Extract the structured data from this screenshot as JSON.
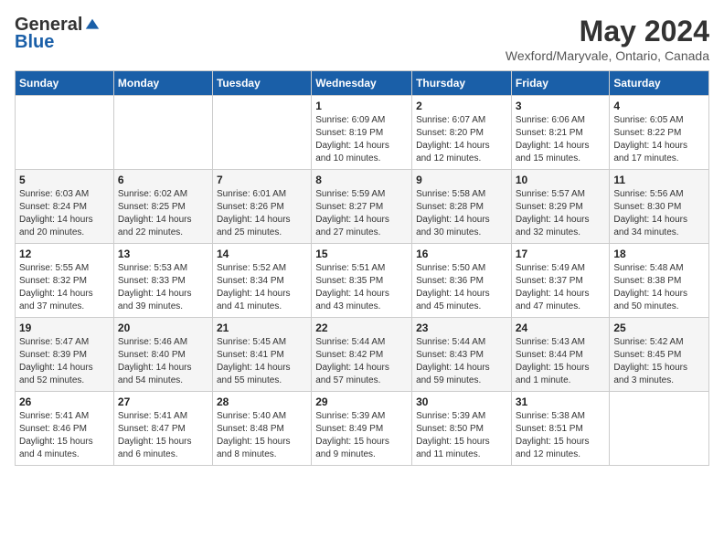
{
  "logo": {
    "general": "General",
    "blue": "Blue"
  },
  "header": {
    "month": "May 2024",
    "location": "Wexford/Maryvale, Ontario, Canada"
  },
  "weekdays": [
    "Sunday",
    "Monday",
    "Tuesday",
    "Wednesday",
    "Thursday",
    "Friday",
    "Saturday"
  ],
  "weeks": [
    [
      {
        "day": "",
        "info": ""
      },
      {
        "day": "",
        "info": ""
      },
      {
        "day": "",
        "info": ""
      },
      {
        "day": "1",
        "info": "Sunrise: 6:09 AM\nSunset: 8:19 PM\nDaylight: 14 hours\nand 10 minutes."
      },
      {
        "day": "2",
        "info": "Sunrise: 6:07 AM\nSunset: 8:20 PM\nDaylight: 14 hours\nand 12 minutes."
      },
      {
        "day": "3",
        "info": "Sunrise: 6:06 AM\nSunset: 8:21 PM\nDaylight: 14 hours\nand 15 minutes."
      },
      {
        "day": "4",
        "info": "Sunrise: 6:05 AM\nSunset: 8:22 PM\nDaylight: 14 hours\nand 17 minutes."
      }
    ],
    [
      {
        "day": "5",
        "info": "Sunrise: 6:03 AM\nSunset: 8:24 PM\nDaylight: 14 hours\nand 20 minutes."
      },
      {
        "day": "6",
        "info": "Sunrise: 6:02 AM\nSunset: 8:25 PM\nDaylight: 14 hours\nand 22 minutes."
      },
      {
        "day": "7",
        "info": "Sunrise: 6:01 AM\nSunset: 8:26 PM\nDaylight: 14 hours\nand 25 minutes."
      },
      {
        "day": "8",
        "info": "Sunrise: 5:59 AM\nSunset: 8:27 PM\nDaylight: 14 hours\nand 27 minutes."
      },
      {
        "day": "9",
        "info": "Sunrise: 5:58 AM\nSunset: 8:28 PM\nDaylight: 14 hours\nand 30 minutes."
      },
      {
        "day": "10",
        "info": "Sunrise: 5:57 AM\nSunset: 8:29 PM\nDaylight: 14 hours\nand 32 minutes."
      },
      {
        "day": "11",
        "info": "Sunrise: 5:56 AM\nSunset: 8:30 PM\nDaylight: 14 hours\nand 34 minutes."
      }
    ],
    [
      {
        "day": "12",
        "info": "Sunrise: 5:55 AM\nSunset: 8:32 PM\nDaylight: 14 hours\nand 37 minutes."
      },
      {
        "day": "13",
        "info": "Sunrise: 5:53 AM\nSunset: 8:33 PM\nDaylight: 14 hours\nand 39 minutes."
      },
      {
        "day": "14",
        "info": "Sunrise: 5:52 AM\nSunset: 8:34 PM\nDaylight: 14 hours\nand 41 minutes."
      },
      {
        "day": "15",
        "info": "Sunrise: 5:51 AM\nSunset: 8:35 PM\nDaylight: 14 hours\nand 43 minutes."
      },
      {
        "day": "16",
        "info": "Sunrise: 5:50 AM\nSunset: 8:36 PM\nDaylight: 14 hours\nand 45 minutes."
      },
      {
        "day": "17",
        "info": "Sunrise: 5:49 AM\nSunset: 8:37 PM\nDaylight: 14 hours\nand 47 minutes."
      },
      {
        "day": "18",
        "info": "Sunrise: 5:48 AM\nSunset: 8:38 PM\nDaylight: 14 hours\nand 50 minutes."
      }
    ],
    [
      {
        "day": "19",
        "info": "Sunrise: 5:47 AM\nSunset: 8:39 PM\nDaylight: 14 hours\nand 52 minutes."
      },
      {
        "day": "20",
        "info": "Sunrise: 5:46 AM\nSunset: 8:40 PM\nDaylight: 14 hours\nand 54 minutes."
      },
      {
        "day": "21",
        "info": "Sunrise: 5:45 AM\nSunset: 8:41 PM\nDaylight: 14 hours\nand 55 minutes."
      },
      {
        "day": "22",
        "info": "Sunrise: 5:44 AM\nSunset: 8:42 PM\nDaylight: 14 hours\nand 57 minutes."
      },
      {
        "day": "23",
        "info": "Sunrise: 5:44 AM\nSunset: 8:43 PM\nDaylight: 14 hours\nand 59 minutes."
      },
      {
        "day": "24",
        "info": "Sunrise: 5:43 AM\nSunset: 8:44 PM\nDaylight: 15 hours\nand 1 minute."
      },
      {
        "day": "25",
        "info": "Sunrise: 5:42 AM\nSunset: 8:45 PM\nDaylight: 15 hours\nand 3 minutes."
      }
    ],
    [
      {
        "day": "26",
        "info": "Sunrise: 5:41 AM\nSunset: 8:46 PM\nDaylight: 15 hours\nand 4 minutes."
      },
      {
        "day": "27",
        "info": "Sunrise: 5:41 AM\nSunset: 8:47 PM\nDaylight: 15 hours\nand 6 minutes."
      },
      {
        "day": "28",
        "info": "Sunrise: 5:40 AM\nSunset: 8:48 PM\nDaylight: 15 hours\nand 8 minutes."
      },
      {
        "day": "29",
        "info": "Sunrise: 5:39 AM\nSunset: 8:49 PM\nDaylight: 15 hours\nand 9 minutes."
      },
      {
        "day": "30",
        "info": "Sunrise: 5:39 AM\nSunset: 8:50 PM\nDaylight: 15 hours\nand 11 minutes."
      },
      {
        "day": "31",
        "info": "Sunrise: 5:38 AM\nSunset: 8:51 PM\nDaylight: 15 hours\nand 12 minutes."
      },
      {
        "day": "",
        "info": ""
      }
    ]
  ]
}
